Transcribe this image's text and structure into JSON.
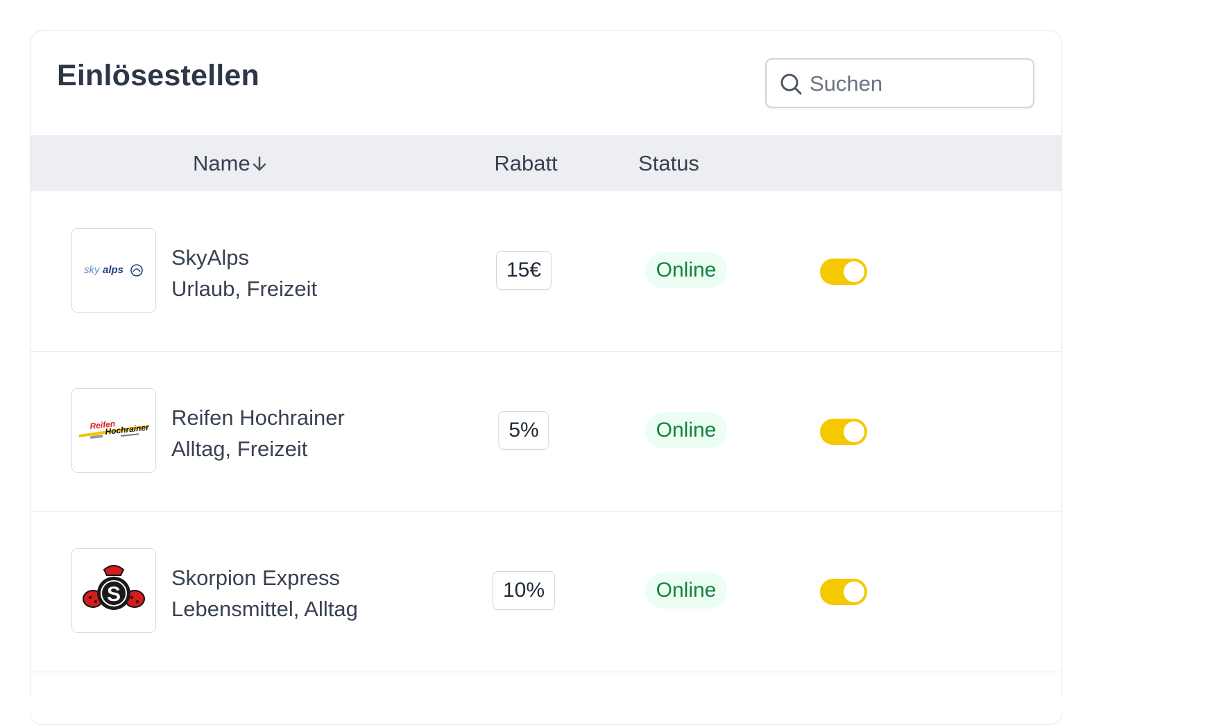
{
  "header": {
    "title": "Einlösestellen",
    "search_placeholder": "Suchen"
  },
  "table": {
    "columns": {
      "name": "Name",
      "rabatt": "Rabatt",
      "status": "Status"
    },
    "sort": {
      "column": "name",
      "direction": "descending-arrow"
    },
    "rows": [
      {
        "name": "SkyAlps",
        "categories": "Urlaub, Freizeit",
        "rabatt": "15€",
        "status": "Online",
        "active": true,
        "logo": "skyalps-logo"
      },
      {
        "name": "Reifen Hochrainer",
        "categories": "Alltag, Freizeit",
        "rabatt": "5%",
        "status": "Online",
        "active": true,
        "logo": "reifen-hochrainer-logo"
      },
      {
        "name": "Skorpion Express",
        "categories": "Lebensmittel, Alltag",
        "rabatt": "10%",
        "status": "Online",
        "active": true,
        "logo": "skorpion-express-logo"
      }
    ]
  },
  "logos": {
    "skyalps": {
      "word_sky": "sky",
      "word_alps": "alps"
    },
    "reifen": {
      "line1": "Reifen",
      "line2": "Hochrainer"
    },
    "skorpion": {
      "letter": "S"
    }
  },
  "colors": {
    "toggle_on": "#f5c800",
    "status_bg": "#ecfdf3",
    "status_text": "#15803d",
    "header_bg": "#edeef1"
  }
}
